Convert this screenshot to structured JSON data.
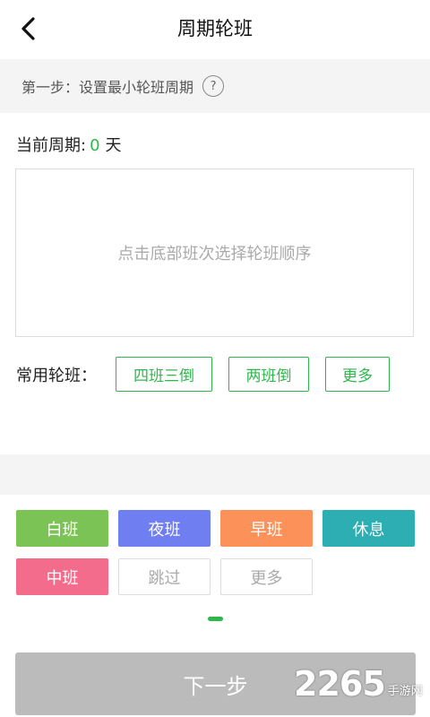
{
  "header": {
    "title": "周期轮班",
    "back_icon": "chevron-left-icon"
  },
  "step": {
    "text": "第一步：设置最小轮班周期",
    "help": "?"
  },
  "period": {
    "label": "当前周期:",
    "value": "0",
    "unit": "天",
    "value_color": "#2eb84b"
  },
  "order_box": {
    "placeholder": "点击底部班次选择轮班顺序"
  },
  "common": {
    "label": "常用轮班：",
    "buttons": [
      "四班三倒",
      "两班倒",
      "更多"
    ]
  },
  "shifts": [
    {
      "label": "白班",
      "color": "#7cc355"
    },
    {
      "label": "夜班",
      "color": "#6f7ef0"
    },
    {
      "label": "早班",
      "color": "#fd915a"
    },
    {
      "label": "休息",
      "color": "#2daeb3"
    },
    {
      "label": "中班",
      "color": "#f36c8c"
    },
    {
      "label": "跳过",
      "color": "#ffffff"
    },
    {
      "label": "更多",
      "color": "#ffffff"
    }
  ],
  "next_button": {
    "label": "下一步"
  },
  "watermark": {
    "number": "2265",
    "suffix": "手游网"
  },
  "colors": {
    "accent": "#2eb84b",
    "disabled": "#bbbbbb"
  }
}
